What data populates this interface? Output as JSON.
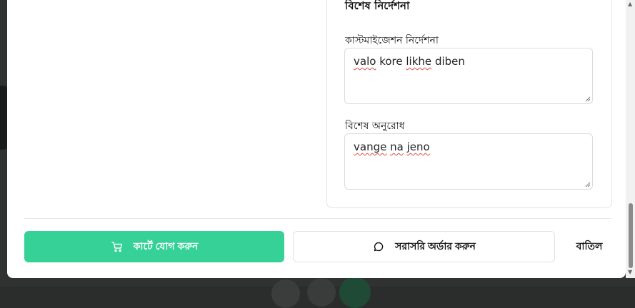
{
  "card": {
    "title": "বিশেষ নির্দেশনা",
    "customization": {
      "label": "কাস্টমাইজেশন নির্দেশনা",
      "value_words": [
        "valo",
        "kore",
        "likhe",
        "diben"
      ]
    },
    "special_request": {
      "label": "বিশেষ অনুরোধ",
      "value_words": [
        "vange",
        "na",
        "jeno"
      ]
    }
  },
  "actions": {
    "add_to_cart": "কার্টে যোগ করুন",
    "order_direct": "সরাসরি অর্ডার করুন",
    "cancel": "বাতিল"
  },
  "icons": {
    "cart": "cart-icon",
    "chat": "chat-bubble-icon"
  },
  "colors": {
    "accent": "#35d197"
  }
}
